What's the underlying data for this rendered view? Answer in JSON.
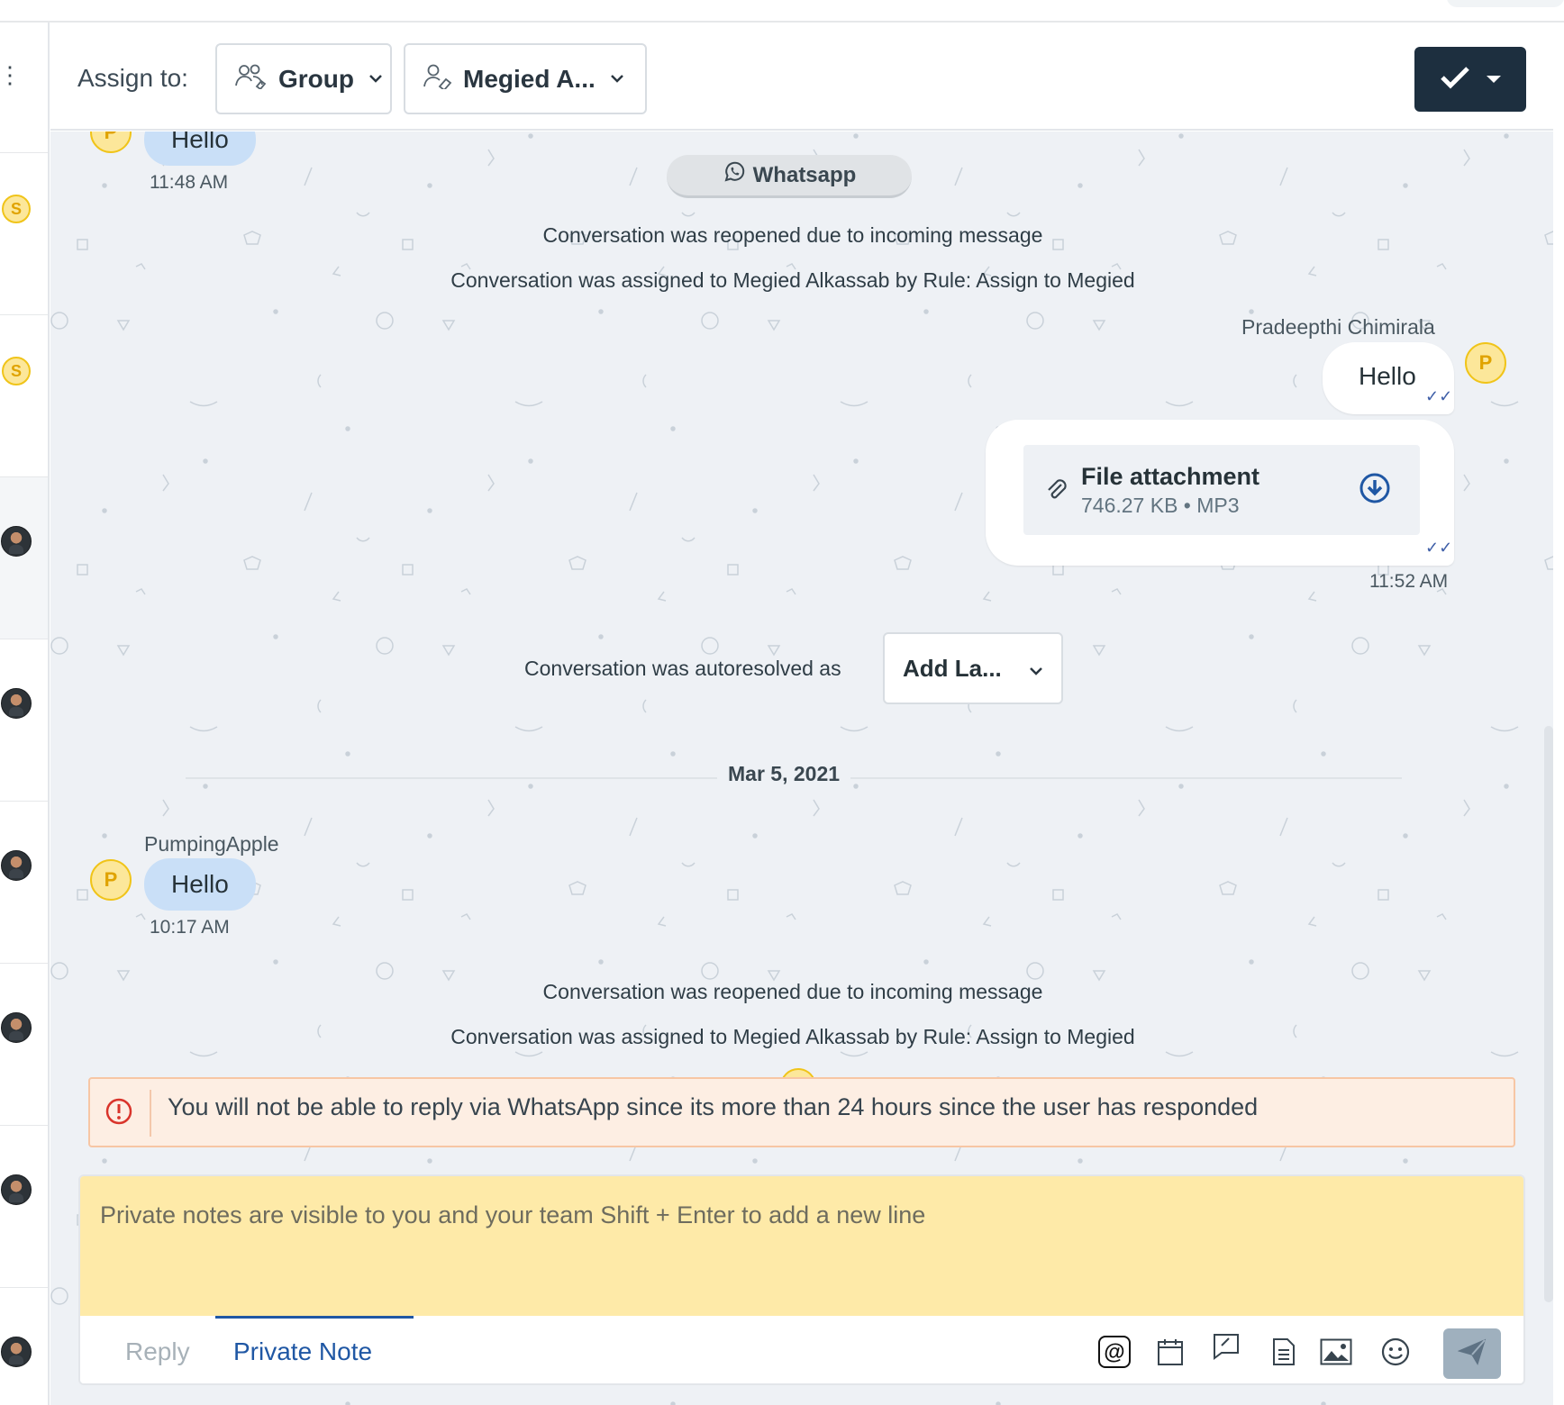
{
  "header": {
    "assign_label": "Assign to:",
    "group_dropdown": "Group",
    "agent_dropdown": "Megied A...",
    "resolve_button_icon": "check-icon"
  },
  "messages": {
    "first_incoming": {
      "text": "Hello",
      "time": "11:48 AM"
    },
    "channel_pill": "Whatsapp",
    "activity_1": "Conversation was reopened due to incoming message",
    "activity_2": "Conversation was assigned to Megied Alkassab by Rule: Assign to Megied",
    "outgoing_sender": "Pradeepthi Chimirala",
    "outgoing_avatar_initial": "P",
    "outgoing_text": "Hello",
    "attachment": {
      "name": "File attachment",
      "meta": "746.27 KB • MP3"
    },
    "outgoing_time": "11:52 AM",
    "autoresolved_text": "Conversation was autoresolved as",
    "label_dropdown": "Add La...",
    "date_separator": "Mar 5, 2021",
    "second_incoming": {
      "sender": "PumpingApple",
      "avatar_initial": "P",
      "text": "Hello",
      "time": "10:17 AM"
    },
    "activity_3": "Conversation was reopened due to incoming message",
    "activity_4": "Conversation was assigned to Megied Alkassab by Rule: Assign to Megied"
  },
  "warning": {
    "text": "You will not be able to reply via WhatsApp since its more than 24 hours since the user has responded"
  },
  "editor": {
    "placeholder": "Private notes are visible to you and your team Shift + Enter to add a new line",
    "tabs": [
      "Reply",
      "Private Note"
    ],
    "active_tab": "Private Note"
  },
  "sidebar": {
    "avatars": [
      {
        "type": "initial",
        "initial": "S"
      },
      {
        "type": "initial",
        "initial": "S"
      },
      {
        "type": "photo"
      },
      {
        "type": "photo"
      },
      {
        "type": "photo"
      },
      {
        "type": "photo"
      },
      {
        "type": "photo"
      },
      {
        "type": "photo"
      }
    ]
  },
  "colors": {
    "primary": "#1f57a4",
    "resolve_button": "#1d2f3f",
    "private_note_bg": "#feeaa8",
    "incoming_bubble": "#c9dff7",
    "warning_bg": "#fdeee3",
    "warning_icon": "#d9342b"
  }
}
